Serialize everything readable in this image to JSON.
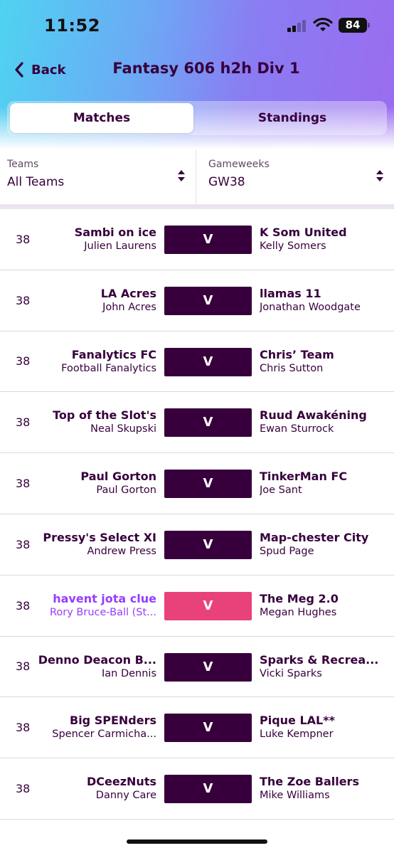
{
  "status": {
    "time": "11:52",
    "battery": "84"
  },
  "nav": {
    "back_label": "Back",
    "title": "Fantasy 606 h2h Div 1"
  },
  "tabs": [
    {
      "label": "Matches",
      "active": true
    },
    {
      "label": "Standings",
      "active": false
    }
  ],
  "filters": {
    "teams": {
      "label": "Teams",
      "value": "All Teams"
    },
    "gameweeks": {
      "label": "Gameweeks",
      "value": "GW38"
    }
  },
  "colors": {
    "primary": "#37003c",
    "highlight_text": "#963cff",
    "highlight_vs": "#e9417a"
  },
  "matches": [
    {
      "gw": "38",
      "home_team": "Sambi on ice",
      "home_manager": "Julien Laurens",
      "vs": "V",
      "away_team": "K Som United",
      "away_manager": "Kelly Somers",
      "highlight": false
    },
    {
      "gw": "38",
      "home_team": "LA Acres",
      "home_manager": "John Acres",
      "vs": "V",
      "away_team": "llamas 11",
      "away_manager": "Jonathan Woodgate",
      "highlight": false
    },
    {
      "gw": "38",
      "home_team": "Fanalytics FC",
      "home_manager": "Football Fanalytics",
      "vs": "V",
      "away_team": "Chris’ Team",
      "away_manager": "Chris Sutton",
      "highlight": false
    },
    {
      "gw": "38",
      "home_team": "Top of the Slot's",
      "home_manager": "Neal Skupski",
      "vs": "V",
      "away_team": "Ruud Awakéning",
      "away_manager": "Ewan Sturrock",
      "highlight": false
    },
    {
      "gw": "38",
      "home_team": "Paul Gorton",
      "home_manager": "Paul Gorton",
      "vs": "V",
      "away_team": "TinkerMan FC",
      "away_manager": "Joe Sant",
      "highlight": false
    },
    {
      "gw": "38",
      "home_team": "Pressy's Select XI",
      "home_manager": "Andrew Press",
      "vs": "V",
      "away_team": "Map-chester City",
      "away_manager": "Spud Page",
      "highlight": false
    },
    {
      "gw": "38",
      "home_team": "havent jota clue",
      "home_manager": "Rory Bruce-Ball (St...",
      "vs": "V",
      "away_team": "The Meg 2.0",
      "away_manager": "Megan Hughes",
      "highlight": true
    },
    {
      "gw": "38",
      "home_team": "Denno Deacon B...",
      "home_manager": "Ian Dennis",
      "vs": "V",
      "away_team": "Sparks & Recrea...",
      "away_manager": "Vicki Sparks",
      "highlight": false
    },
    {
      "gw": "38",
      "home_team": "Big SPENders",
      "home_manager": "Spencer Carmicha...",
      "vs": "V",
      "away_team": "Pique LAL**",
      "away_manager": "Luke Kempner",
      "highlight": false
    },
    {
      "gw": "38",
      "home_team": "DCeezNuts",
      "home_manager": "Danny Care",
      "vs": "V",
      "away_team": "The Zoe Ballers",
      "away_manager": "Mike Williams",
      "highlight": false
    }
  ]
}
